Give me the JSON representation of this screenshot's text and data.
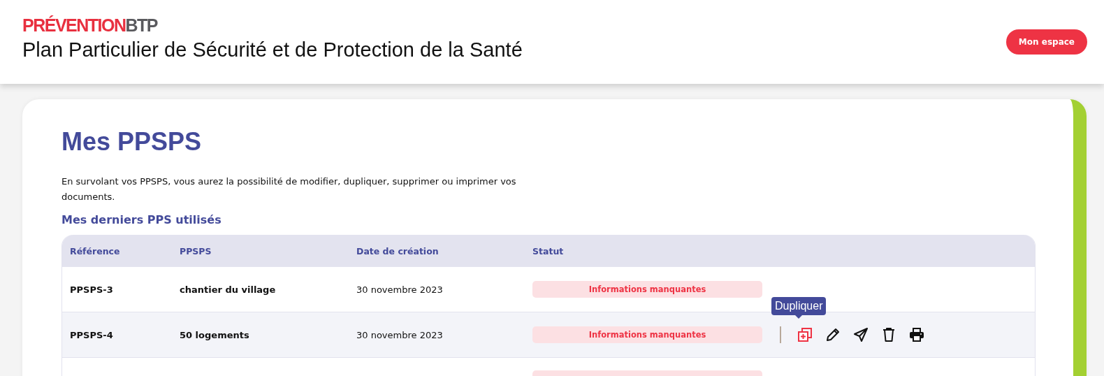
{
  "header": {
    "logo": {
      "part_1": "PRÉVENTION",
      "part_2": "BTP"
    },
    "title": "Plan Particulier de Sécurité et de Protection de la Santé",
    "account_button": "Mon espace"
  },
  "page": {
    "title": "Mes PPSPS",
    "intro": "En survolant vos PPSPS, vous aurez la possibilité de modifier, dupliquer, supprimer ou imprimer vos documents.",
    "section_title": "Mes derniers PPS utilisés"
  },
  "table": {
    "columns": [
      "Référence",
      "PPSPS",
      "Date de création",
      "Statut"
    ],
    "rows": [
      {
        "reference": "PPSPS-3",
        "ppsps": "chantier du village",
        "date": "30 novembre 2023",
        "status": "Informations manquantes",
        "hovered": false
      },
      {
        "reference": "PPSPS-4",
        "ppsps": "50 logements",
        "date": "30 novembre 2023",
        "status": "Informations manquantes",
        "hovered": true
      },
      {
        "hovered": false
      }
    ],
    "actions": [
      {
        "kind": "duplicate",
        "active": true,
        "tooltip": "Dupliquer"
      },
      {
        "kind": "edit",
        "active": false
      },
      {
        "kind": "send",
        "active": false
      },
      {
        "kind": "delete",
        "active": false
      },
      {
        "kind": "print",
        "active": false
      }
    ]
  }
}
